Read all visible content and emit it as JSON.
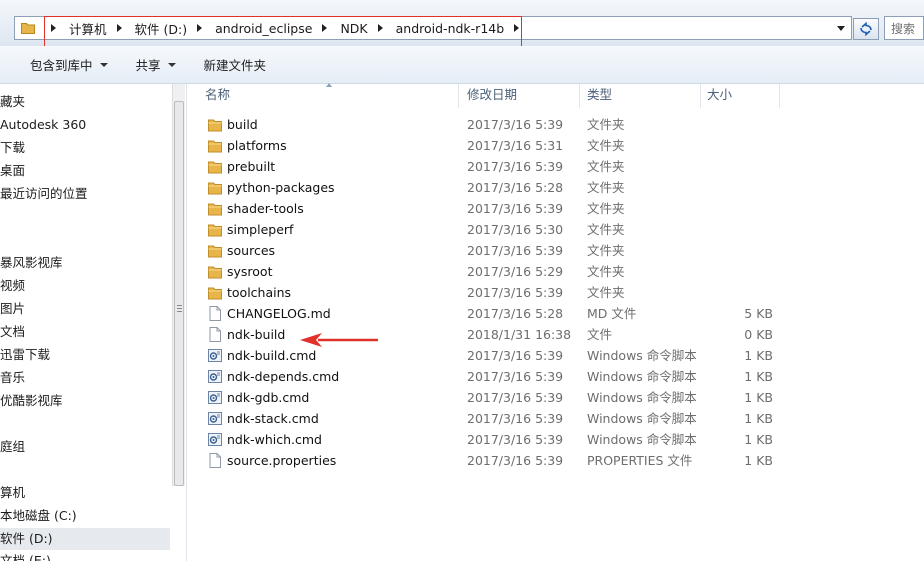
{
  "address": {
    "crumbs": [
      "计算机",
      "软件 (D:)",
      "android_eclipse",
      "NDK",
      "android-ndk-r14b"
    ],
    "search_placeholder": "搜索"
  },
  "toolbar": {
    "include_label": "包含到库中",
    "share_label": "共享",
    "new_folder_label": "新建文件夹"
  },
  "nav": {
    "items": [
      "藏夹",
      "Autodesk 360",
      "下载",
      "桌面",
      "最近访问的位置",
      "暴风影视库",
      "视频",
      "图片",
      "文档",
      "迅雷下载",
      "音乐",
      "优酷影视库",
      "庭组",
      "算机",
      "本地磁盘 (C:)",
      "软件 (D:)",
      "文档 (E:)"
    ],
    "selected": "软件 (D:)"
  },
  "columns": {
    "name": "名称",
    "date": "修改日期",
    "type": "类型",
    "size": "大小"
  },
  "files": [
    {
      "name": "build",
      "date": "2017/3/16 5:39",
      "type": "文件夹",
      "size": "",
      "icon": "folder-icon"
    },
    {
      "name": "platforms",
      "date": "2017/3/16 5:31",
      "type": "文件夹",
      "size": "",
      "icon": "folder-icon"
    },
    {
      "name": "prebuilt",
      "date": "2017/3/16 5:39",
      "type": "文件夹",
      "size": "",
      "icon": "folder-icon"
    },
    {
      "name": "python-packages",
      "date": "2017/3/16 5:28",
      "type": "文件夹",
      "size": "",
      "icon": "folder-icon"
    },
    {
      "name": "shader-tools",
      "date": "2017/3/16 5:39",
      "type": "文件夹",
      "size": "",
      "icon": "folder-icon"
    },
    {
      "name": "simpleperf",
      "date": "2017/3/16 5:30",
      "type": "文件夹",
      "size": "",
      "icon": "folder-icon"
    },
    {
      "name": "sources",
      "date": "2017/3/16 5:39",
      "type": "文件夹",
      "size": "",
      "icon": "folder-icon"
    },
    {
      "name": "sysroot",
      "date": "2017/3/16 5:29",
      "type": "文件夹",
      "size": "",
      "icon": "folder-icon"
    },
    {
      "name": "toolchains",
      "date": "2017/3/16 5:39",
      "type": "文件夹",
      "size": "",
      "icon": "folder-icon"
    },
    {
      "name": "CHANGELOG.md",
      "date": "2017/3/16 5:28",
      "type": "MD 文件",
      "size": "5 KB",
      "icon": "document-icon"
    },
    {
      "name": "ndk-build",
      "date": "2018/1/31 16:38",
      "type": "文件",
      "size": "0 KB",
      "icon": "document-icon"
    },
    {
      "name": "ndk-build.cmd",
      "date": "2017/3/16 5:39",
      "type": "Windows 命令脚本",
      "size": "1 KB",
      "icon": "script-icon"
    },
    {
      "name": "ndk-depends.cmd",
      "date": "2017/3/16 5:39",
      "type": "Windows 命令脚本",
      "size": "1 KB",
      "icon": "script-icon"
    },
    {
      "name": "ndk-gdb.cmd",
      "date": "2017/3/16 5:39",
      "type": "Windows 命令脚本",
      "size": "1 KB",
      "icon": "script-icon"
    },
    {
      "name": "ndk-stack.cmd",
      "date": "2017/3/16 5:39",
      "type": "Windows 命令脚本",
      "size": "1 KB",
      "icon": "script-icon"
    },
    {
      "name": "ndk-which.cmd",
      "date": "2017/3/16 5:39",
      "type": "Windows 命令脚本",
      "size": "1 KB",
      "icon": "script-icon"
    },
    {
      "name": "source.properties",
      "date": "2017/3/16 5:39",
      "type": "PROPERTIES 文件",
      "size": "1 KB",
      "icon": "document-icon"
    }
  ],
  "colors": {
    "annotation_red": "#e0312b",
    "folder_yellow": "#e8b54a",
    "header_text": "#4c607a"
  }
}
